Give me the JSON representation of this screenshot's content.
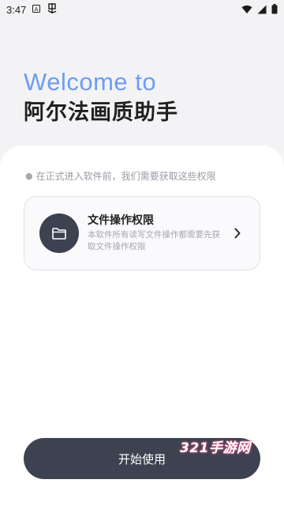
{
  "status_bar": {
    "time": "3:47",
    "notification_icons": [
      "font-a-icon",
      "app-notification-icon"
    ],
    "system_icons": [
      "wifi-icon",
      "signal-icon",
      "battery-icon"
    ]
  },
  "header": {
    "welcome": "Welcome to",
    "app_name": "阿尔法画质助手"
  },
  "permissions": {
    "hint": "在正式进入软件前，我们需要获取这些权限",
    "items": [
      {
        "title": "文件操作权限",
        "description": "本软件所有读写文件操作都需要先获取文件操作权限",
        "icon": "folder-icon"
      }
    ]
  },
  "start_button": {
    "label": "开始使用"
  },
  "watermark": {
    "text": "321手游网"
  },
  "colors": {
    "welcome_blue": "#6d9cf5",
    "dark_button": "#3c4250",
    "background": "#f3f3f5",
    "sheet": "#ffffff"
  }
}
